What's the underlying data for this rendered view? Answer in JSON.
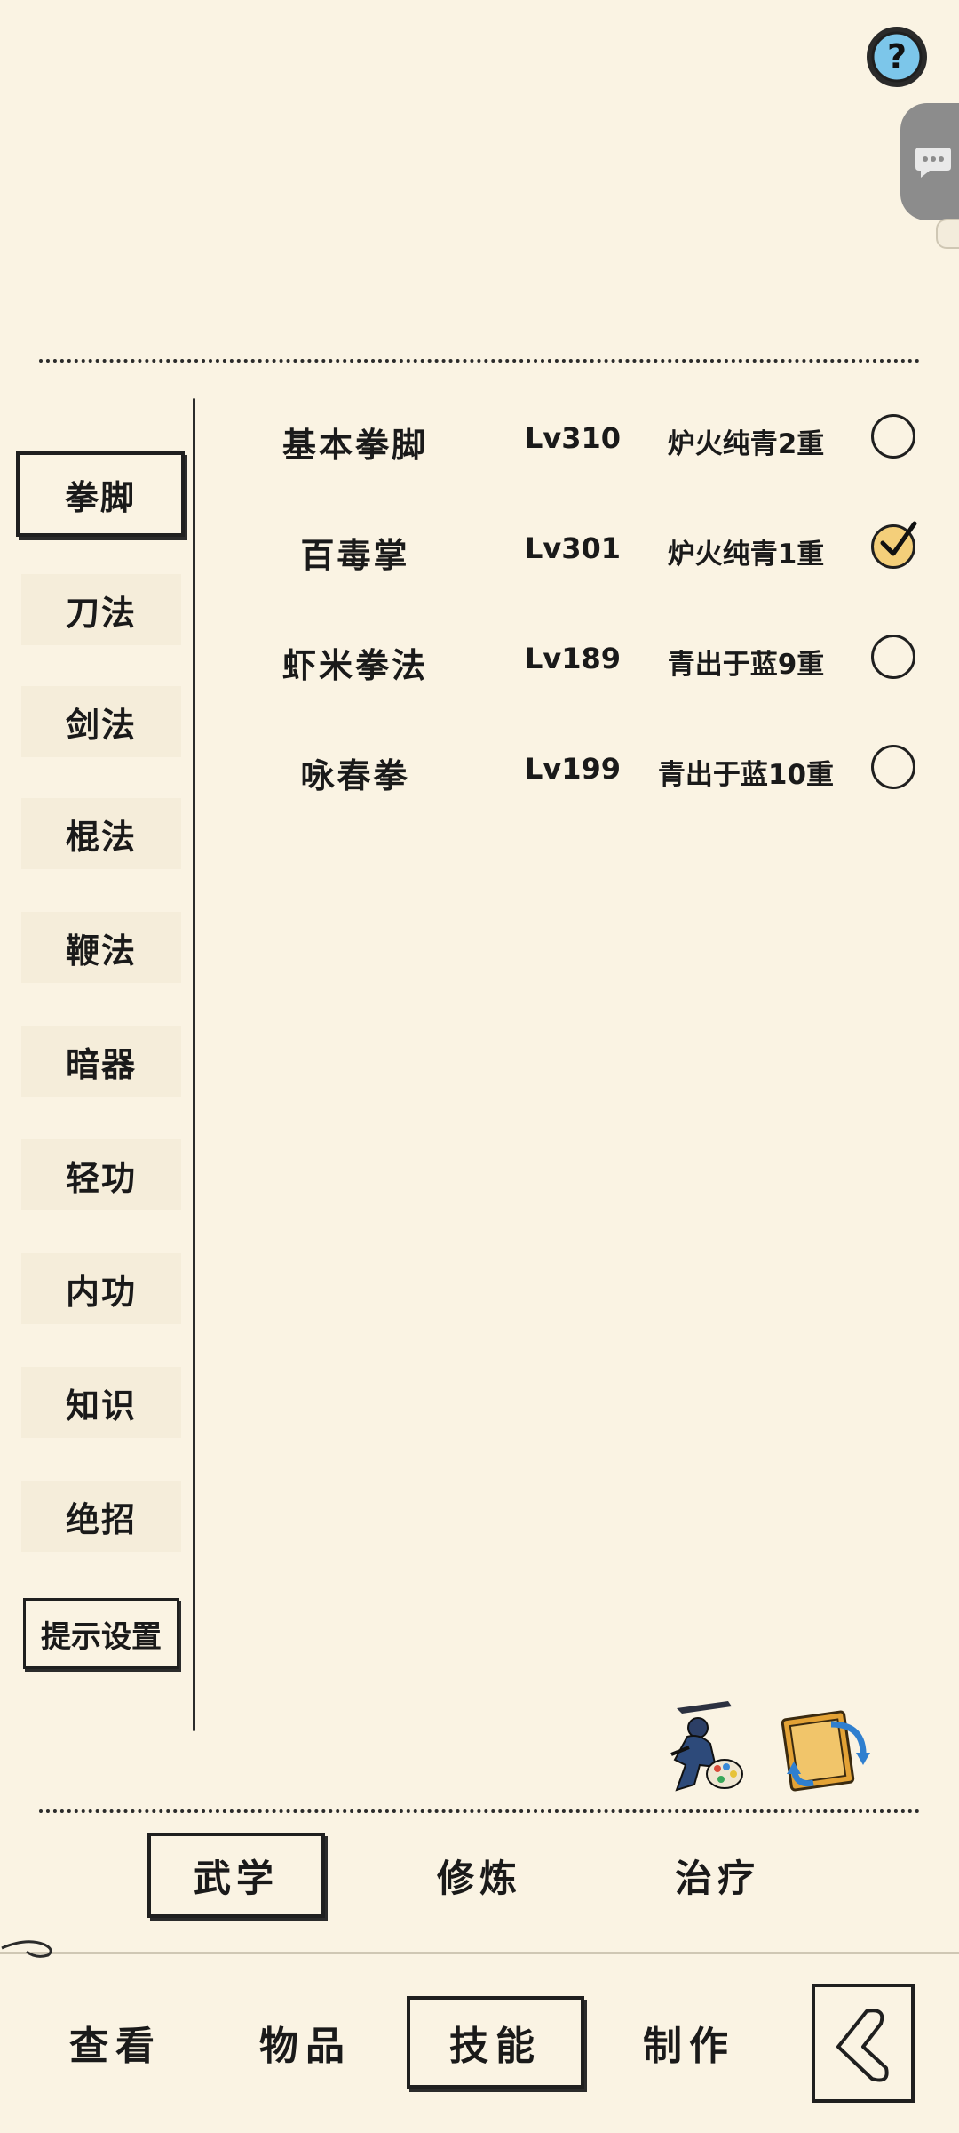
{
  "categories": [
    {
      "label": "拳脚",
      "active": true
    },
    {
      "label": "刀法"
    },
    {
      "label": "剑法"
    },
    {
      "label": "棍法"
    },
    {
      "label": "鞭法"
    },
    {
      "label": "暗器"
    },
    {
      "label": "轻功"
    },
    {
      "label": "内功"
    },
    {
      "label": "知识"
    },
    {
      "label": "绝招"
    }
  ],
  "hint_settings_label": "提示设置",
  "skills": [
    {
      "name": "基本拳脚",
      "level": "Lv310",
      "rank": "炉火纯青2重",
      "checked": false
    },
    {
      "name": "百毒掌",
      "level": "Lv301",
      "rank": "炉火纯青1重",
      "checked": true
    },
    {
      "name": "虾米拳法",
      "level": "Lv189",
      "rank": "青出于蓝9重",
      "checked": false
    },
    {
      "name": "咏春拳",
      "level": "Lv199",
      "rank": "青出于蓝10重",
      "checked": false
    }
  ],
  "subtabs": [
    "武学",
    "修炼",
    "治疗"
  ],
  "active_subtab": "武学",
  "nav": [
    "查看",
    "物品",
    "技能",
    "制作"
  ],
  "active_nav": "技能",
  "icons": {
    "help": "question-icon",
    "chat": "chat-bubble-icon",
    "ninja": "ninja-palette-icon",
    "book": "book-swap-icon",
    "back": "back-arrow-icon"
  },
  "colors": {
    "background": "#faf3e3",
    "ink": "#1a1a1a",
    "checked_fill": "#f4cf7a"
  }
}
